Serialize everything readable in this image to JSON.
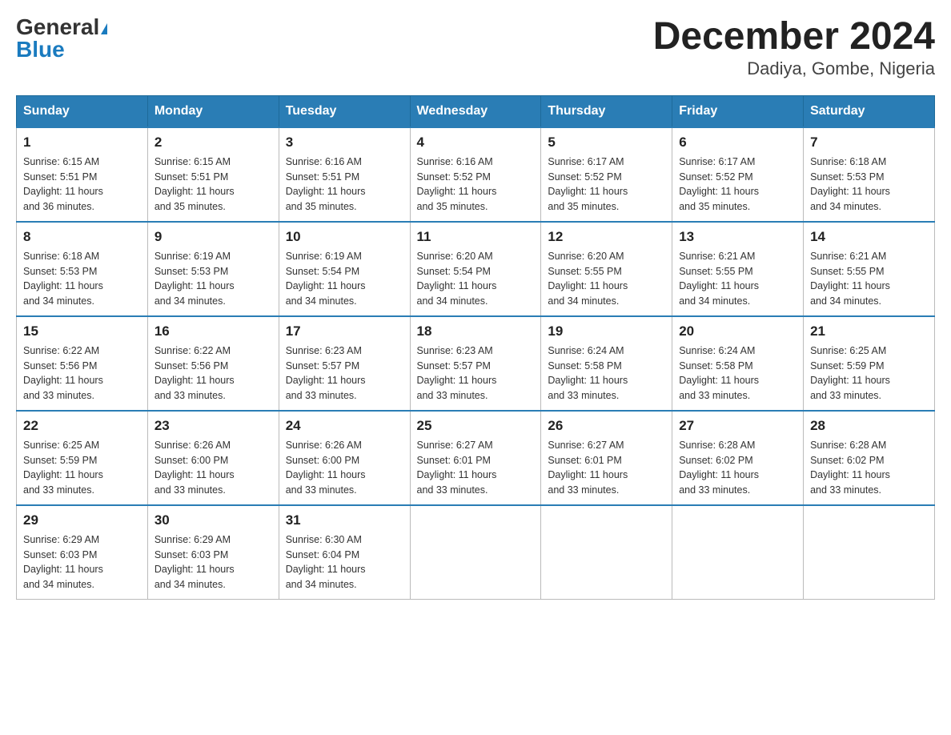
{
  "header": {
    "logo": {
      "general": "General",
      "blue": "Blue"
    },
    "title": "December 2024",
    "location": "Dadiya, Gombe, Nigeria"
  },
  "days_of_week": [
    "Sunday",
    "Monday",
    "Tuesday",
    "Wednesday",
    "Thursday",
    "Friday",
    "Saturday"
  ],
  "weeks": [
    [
      {
        "day": "1",
        "sunrise": "6:15 AM",
        "sunset": "5:51 PM",
        "daylight": "11 hours and 36 minutes."
      },
      {
        "day": "2",
        "sunrise": "6:15 AM",
        "sunset": "5:51 PM",
        "daylight": "11 hours and 35 minutes."
      },
      {
        "day": "3",
        "sunrise": "6:16 AM",
        "sunset": "5:51 PM",
        "daylight": "11 hours and 35 minutes."
      },
      {
        "day": "4",
        "sunrise": "6:16 AM",
        "sunset": "5:52 PM",
        "daylight": "11 hours and 35 minutes."
      },
      {
        "day": "5",
        "sunrise": "6:17 AM",
        "sunset": "5:52 PM",
        "daylight": "11 hours and 35 minutes."
      },
      {
        "day": "6",
        "sunrise": "6:17 AM",
        "sunset": "5:52 PM",
        "daylight": "11 hours and 35 minutes."
      },
      {
        "day": "7",
        "sunrise": "6:18 AM",
        "sunset": "5:53 PM",
        "daylight": "11 hours and 34 minutes."
      }
    ],
    [
      {
        "day": "8",
        "sunrise": "6:18 AM",
        "sunset": "5:53 PM",
        "daylight": "11 hours and 34 minutes."
      },
      {
        "day": "9",
        "sunrise": "6:19 AM",
        "sunset": "5:53 PM",
        "daylight": "11 hours and 34 minutes."
      },
      {
        "day": "10",
        "sunrise": "6:19 AM",
        "sunset": "5:54 PM",
        "daylight": "11 hours and 34 minutes."
      },
      {
        "day": "11",
        "sunrise": "6:20 AM",
        "sunset": "5:54 PM",
        "daylight": "11 hours and 34 minutes."
      },
      {
        "day": "12",
        "sunrise": "6:20 AM",
        "sunset": "5:55 PM",
        "daylight": "11 hours and 34 minutes."
      },
      {
        "day": "13",
        "sunrise": "6:21 AM",
        "sunset": "5:55 PM",
        "daylight": "11 hours and 34 minutes."
      },
      {
        "day": "14",
        "sunrise": "6:21 AM",
        "sunset": "5:55 PM",
        "daylight": "11 hours and 34 minutes."
      }
    ],
    [
      {
        "day": "15",
        "sunrise": "6:22 AM",
        "sunset": "5:56 PM",
        "daylight": "11 hours and 33 minutes."
      },
      {
        "day": "16",
        "sunrise": "6:22 AM",
        "sunset": "5:56 PM",
        "daylight": "11 hours and 33 minutes."
      },
      {
        "day": "17",
        "sunrise": "6:23 AM",
        "sunset": "5:57 PM",
        "daylight": "11 hours and 33 minutes."
      },
      {
        "day": "18",
        "sunrise": "6:23 AM",
        "sunset": "5:57 PM",
        "daylight": "11 hours and 33 minutes."
      },
      {
        "day": "19",
        "sunrise": "6:24 AM",
        "sunset": "5:58 PM",
        "daylight": "11 hours and 33 minutes."
      },
      {
        "day": "20",
        "sunrise": "6:24 AM",
        "sunset": "5:58 PM",
        "daylight": "11 hours and 33 minutes."
      },
      {
        "day": "21",
        "sunrise": "6:25 AM",
        "sunset": "5:59 PM",
        "daylight": "11 hours and 33 minutes."
      }
    ],
    [
      {
        "day": "22",
        "sunrise": "6:25 AM",
        "sunset": "5:59 PM",
        "daylight": "11 hours and 33 minutes."
      },
      {
        "day": "23",
        "sunrise": "6:26 AM",
        "sunset": "6:00 PM",
        "daylight": "11 hours and 33 minutes."
      },
      {
        "day": "24",
        "sunrise": "6:26 AM",
        "sunset": "6:00 PM",
        "daylight": "11 hours and 33 minutes."
      },
      {
        "day": "25",
        "sunrise": "6:27 AM",
        "sunset": "6:01 PM",
        "daylight": "11 hours and 33 minutes."
      },
      {
        "day": "26",
        "sunrise": "6:27 AM",
        "sunset": "6:01 PM",
        "daylight": "11 hours and 33 minutes."
      },
      {
        "day": "27",
        "sunrise": "6:28 AM",
        "sunset": "6:02 PM",
        "daylight": "11 hours and 33 minutes."
      },
      {
        "day": "28",
        "sunrise": "6:28 AM",
        "sunset": "6:02 PM",
        "daylight": "11 hours and 33 minutes."
      }
    ],
    [
      {
        "day": "29",
        "sunrise": "6:29 AM",
        "sunset": "6:03 PM",
        "daylight": "11 hours and 34 minutes."
      },
      {
        "day": "30",
        "sunrise": "6:29 AM",
        "sunset": "6:03 PM",
        "daylight": "11 hours and 34 minutes."
      },
      {
        "day": "31",
        "sunrise": "6:30 AM",
        "sunset": "6:04 PM",
        "daylight": "11 hours and 34 minutes."
      },
      null,
      null,
      null,
      null
    ]
  ],
  "labels": {
    "sunrise": "Sunrise:",
    "sunset": "Sunset:",
    "daylight": "Daylight:"
  }
}
